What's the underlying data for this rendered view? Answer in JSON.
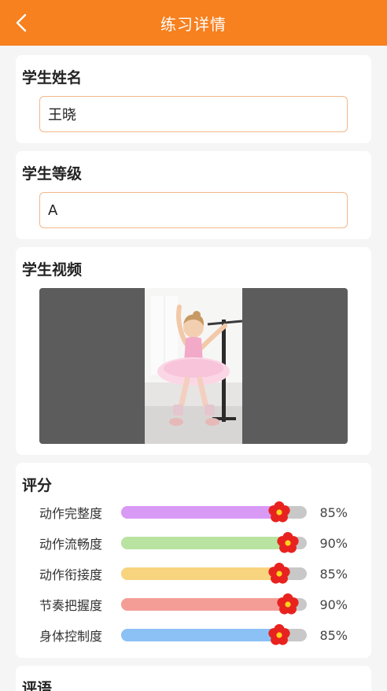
{
  "header": {
    "title": "练习详情",
    "back_icon": "chevron-left-icon",
    "background": "#f7801f"
  },
  "student_name": {
    "label": "学生姓名",
    "value": "王晓"
  },
  "student_grade": {
    "label": "学生等级",
    "value": "A"
  },
  "student_video": {
    "label": "学生视频"
  },
  "scores": {
    "label": "评分",
    "items": [
      {
        "label": "动作完整度",
        "percent": 85,
        "percent_text": "85%",
        "color": "#d99af5"
      },
      {
        "label": "动作流畅度",
        "percent": 90,
        "percent_text": "90%",
        "color": "#b8e3a0"
      },
      {
        "label": "动作衔接度",
        "percent": 85,
        "percent_text": "85%",
        "color": "#f9d47f"
      },
      {
        "label": "节奏把握度",
        "percent": 90,
        "percent_text": "90%",
        "color": "#f49d97"
      },
      {
        "label": "身体控制度",
        "percent": 85,
        "percent_text": "85%",
        "color": "#8cc1f5"
      }
    ]
  },
  "comments": {
    "label": "评语"
  }
}
